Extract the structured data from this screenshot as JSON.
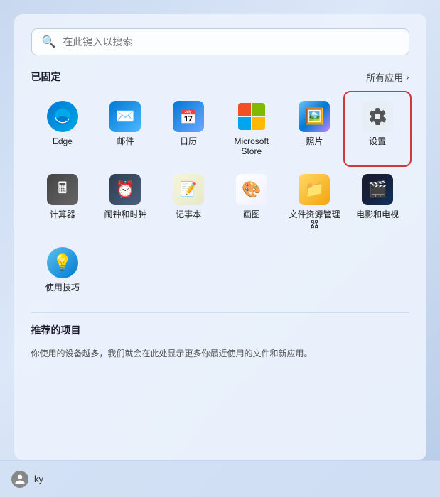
{
  "search": {
    "placeholder": "在此键入以搜索"
  },
  "pinned": {
    "section_title": "已固定",
    "all_apps_label": "所有应用",
    "apps": [
      {
        "id": "edge",
        "label": "Edge",
        "icon_type": "edge"
      },
      {
        "id": "mail",
        "label": "邮件",
        "icon_type": "mail"
      },
      {
        "id": "calendar",
        "label": "日历",
        "icon_type": "calendar"
      },
      {
        "id": "store",
        "label": "Microsoft Store",
        "icon_type": "store"
      },
      {
        "id": "photos",
        "label": "照片",
        "icon_type": "photos"
      },
      {
        "id": "settings",
        "label": "设置",
        "icon_type": "settings",
        "highlighted": true
      },
      {
        "id": "calculator",
        "label": "计算器",
        "icon_type": "calc"
      },
      {
        "id": "clock",
        "label": "闹钟和时钟",
        "icon_type": "clock"
      },
      {
        "id": "notepad",
        "label": "记事本",
        "icon_type": "notepad"
      },
      {
        "id": "paint",
        "label": "画图",
        "icon_type": "paint"
      },
      {
        "id": "explorer",
        "label": "文件资源管理器",
        "icon_type": "folder"
      },
      {
        "id": "movies",
        "label": "电影和电视",
        "icon_type": "movies"
      },
      {
        "id": "tips",
        "label": "使用技巧",
        "icon_type": "tips"
      }
    ]
  },
  "recommended": {
    "section_title": "推荐的项目",
    "description": "你使用的设备越多，我们就会在此处显示更多你最近使用的文件和新应用。"
  },
  "taskbar": {
    "user_label": "ky"
  }
}
